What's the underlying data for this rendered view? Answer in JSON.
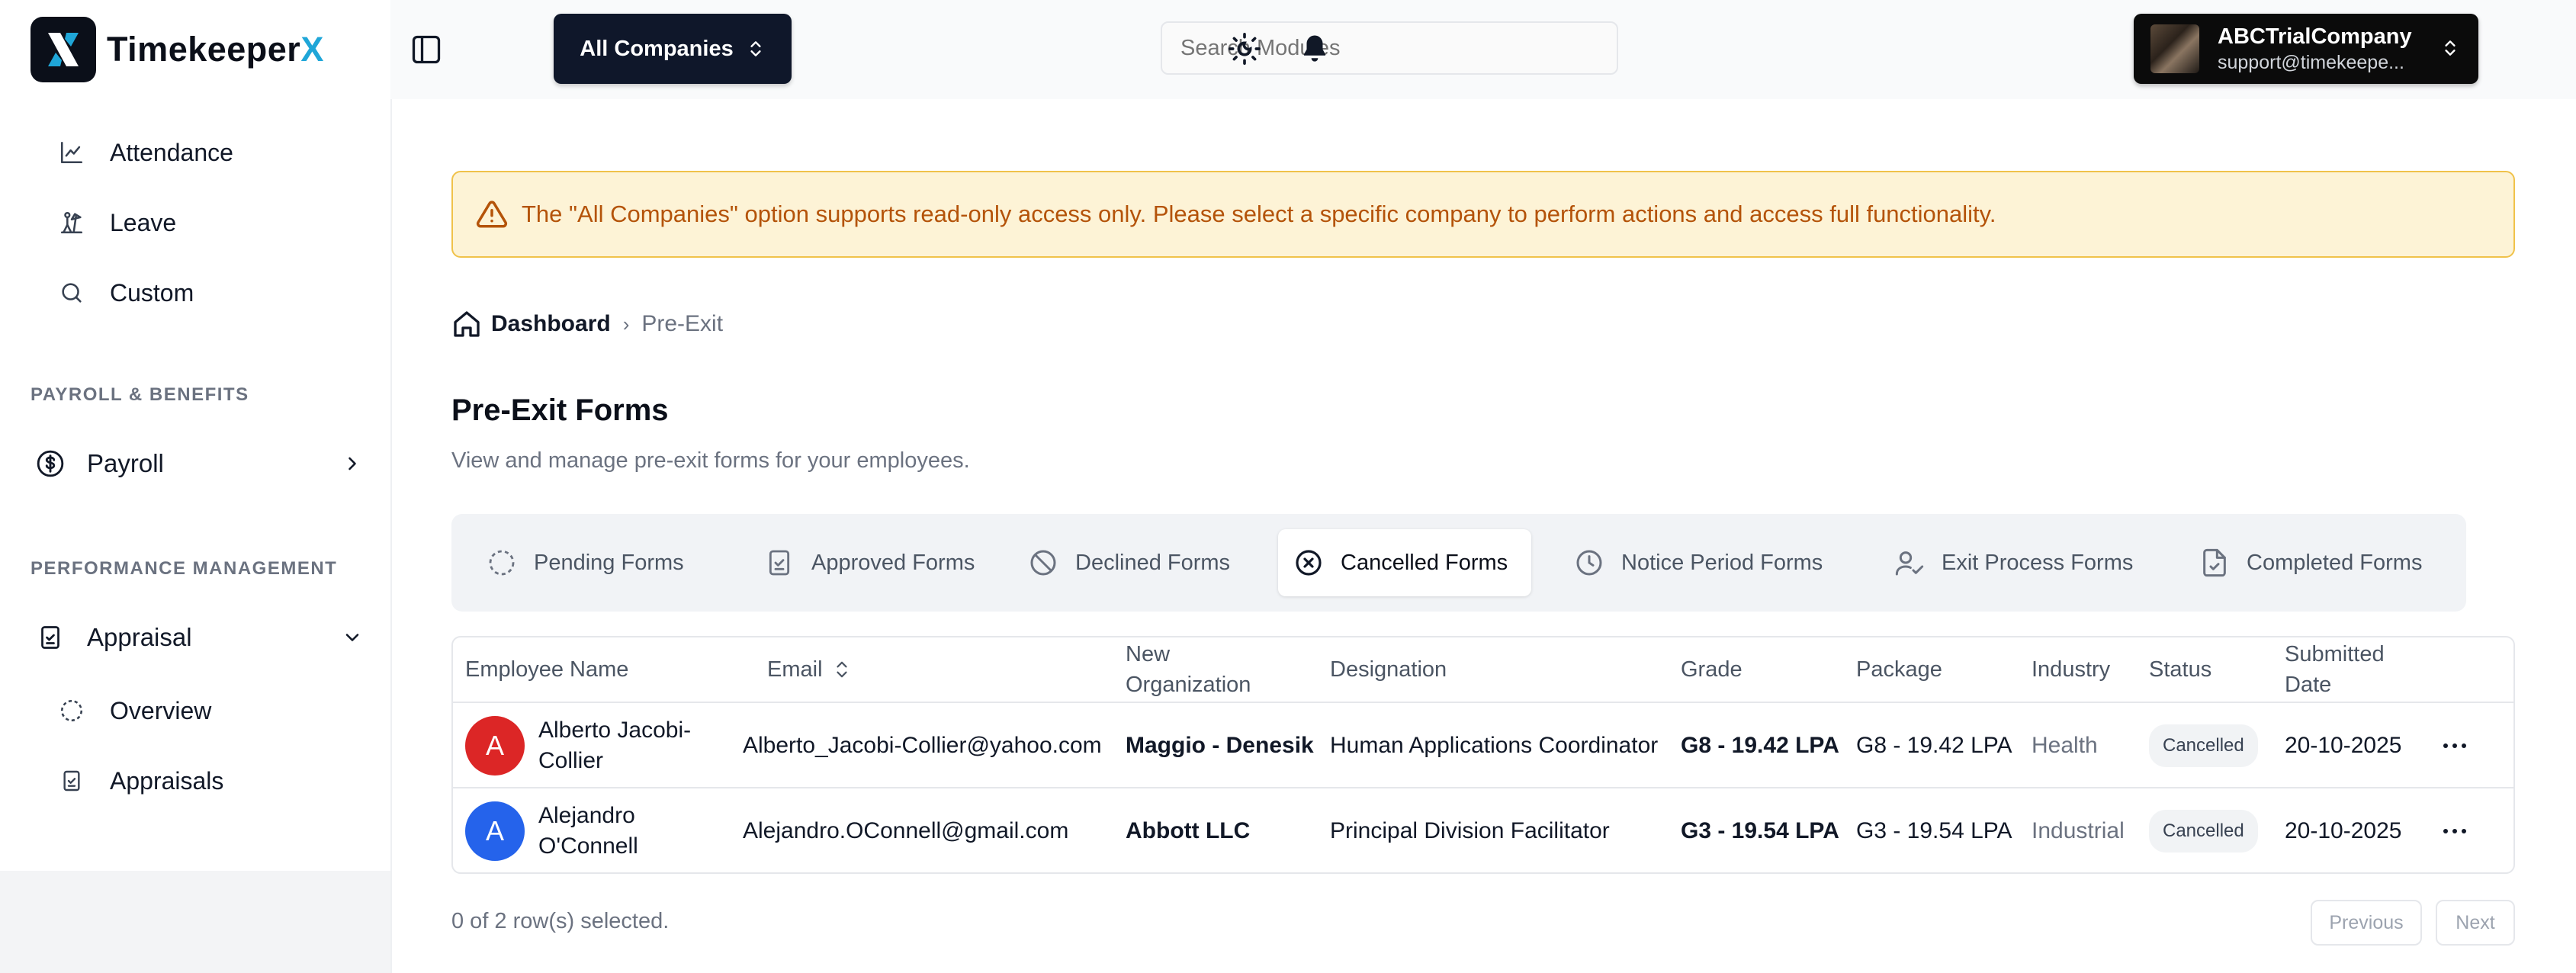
{
  "app": {
    "brand_main": "Timekeeper",
    "brand_accent": "X"
  },
  "sidebar": {
    "items": [
      {
        "label": "Attendance"
      },
      {
        "label": "Leave"
      },
      {
        "label": "Custom"
      }
    ],
    "sections": [
      {
        "title": "PAYROLL & BENEFITS",
        "item": "Payroll"
      },
      {
        "title": "PERFORMANCE MANAGEMENT",
        "item": "Appraisal"
      }
    ],
    "appraisal_children": [
      {
        "label": "Overview"
      },
      {
        "label": "Appraisals"
      }
    ]
  },
  "topbar": {
    "company_select": "All Companies",
    "search_placeholder": "Search Modules",
    "account_name": "ABCTrialCompany",
    "account_email": "support@timekeepe..."
  },
  "alert": {
    "text": "The \"All Companies\" option supports read-only access only. Please select a specific company to perform actions and access full functionality."
  },
  "breadcrumb": {
    "home": "Dashboard",
    "separator": "›",
    "current": "Pre-Exit"
  },
  "page": {
    "title": "Pre-Exit Forms",
    "subtitle": "View and manage pre-exit forms for your employees."
  },
  "tabs": [
    {
      "label": "Pending Forms",
      "icon": "dashed-circle-icon"
    },
    {
      "label": "Approved Forms",
      "icon": "clipboard-check-icon"
    },
    {
      "label": "Declined Forms",
      "icon": "ban-icon"
    },
    {
      "label": "Cancelled Forms",
      "icon": "x-circle-icon",
      "active": true
    },
    {
      "label": "Notice Period Forms",
      "icon": "clock-icon"
    },
    {
      "label": "Exit Process Forms",
      "icon": "user-check-icon"
    },
    {
      "label": "Completed Forms",
      "icon": "file-check-icon"
    }
  ],
  "table": {
    "headers": {
      "employee_name": "Employee Name",
      "email": "Email",
      "new_org_1": "New",
      "new_org_2": "Organization",
      "designation": "Designation",
      "grade": "Grade",
      "package": "Package",
      "industry": "Industry",
      "status": "Status",
      "submitted_1": "Submitted",
      "submitted_2": "Date"
    },
    "rows": [
      {
        "initial": "A",
        "avatar_color": "#dc2626",
        "name_1": "Alberto Jacobi-",
        "name_2": "Collier",
        "email": "Alberto_Jacobi-Collier@yahoo.com",
        "organization": "Maggio - Denesik",
        "designation": "Human Applications Coordinator",
        "grade": "G8 - 19.42 LPA",
        "package": "G8 - 19.42 LPA",
        "industry": "Health",
        "status": "Cancelled",
        "submitted": "20-10-2025"
      },
      {
        "initial": "A",
        "avatar_color": "#2563eb",
        "name_1": "Alejandro",
        "name_2": "O'Connell",
        "email": "Alejandro.OConnell@gmail.com",
        "organization": "Abbott LLC",
        "designation": "Principal Division Facilitator",
        "grade": "G3 - 19.54 LPA",
        "package": "G3 - 19.54 LPA",
        "industry": "Industrial",
        "status": "Cancelled",
        "submitted": "20-10-2025"
      }
    ]
  },
  "footer": {
    "selection": "0 of 2 row(s) selected.",
    "previous": "Previous",
    "next": "Next"
  }
}
